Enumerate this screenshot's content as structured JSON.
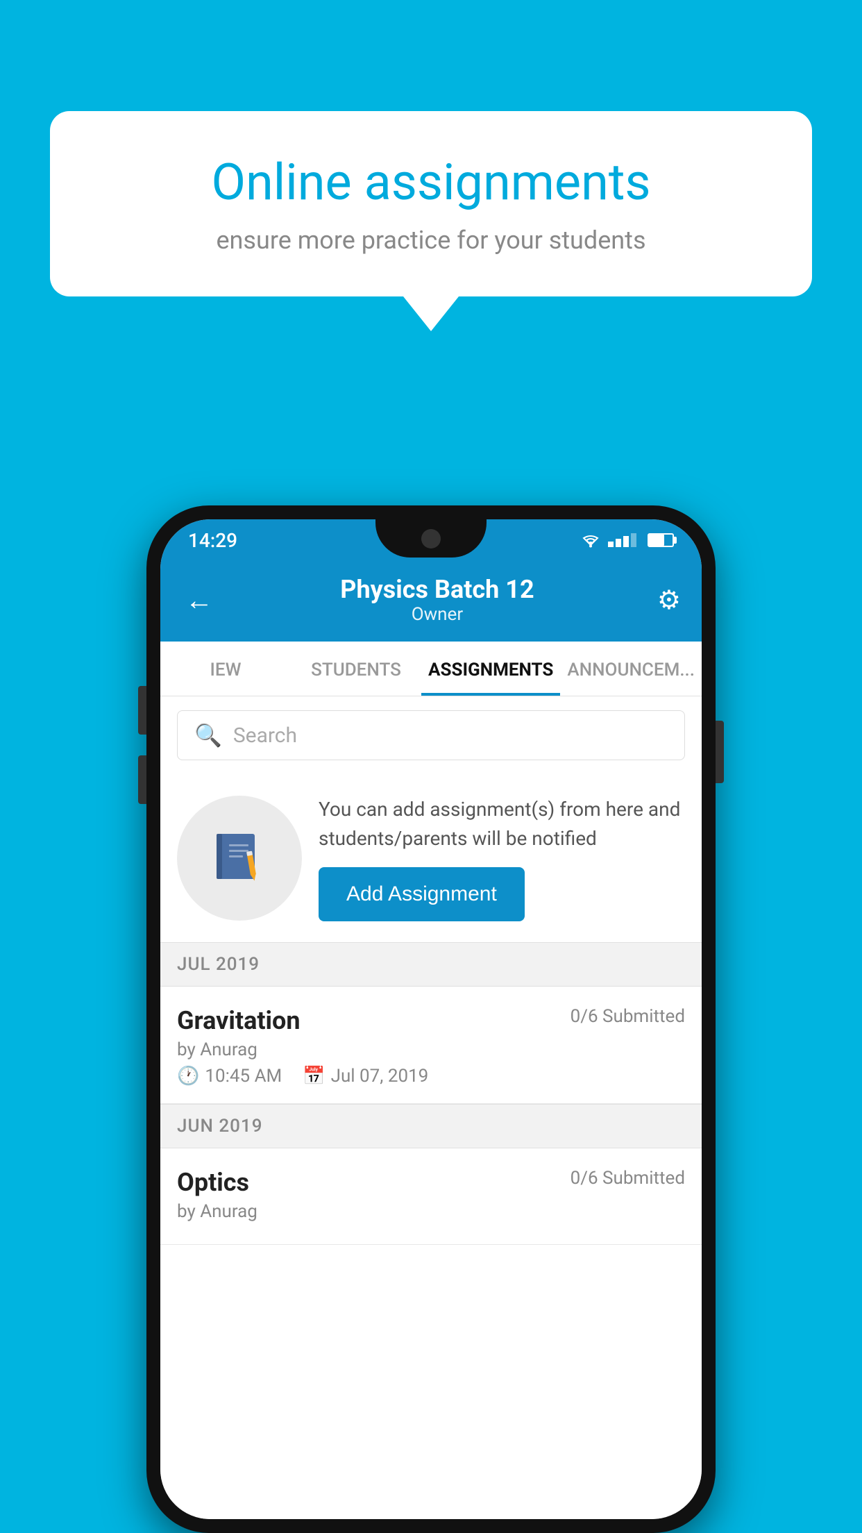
{
  "background": {
    "color": "#00b4e0"
  },
  "speech_bubble": {
    "title": "Online assignments",
    "subtitle": "ensure more practice for your students"
  },
  "phone": {
    "status_bar": {
      "time": "14:29"
    },
    "header": {
      "title": "Physics Batch 12",
      "subtitle": "Owner",
      "back_label": "←",
      "gear_label": "⚙"
    },
    "tabs": [
      {
        "label": "IEW",
        "active": false
      },
      {
        "label": "STUDENTS",
        "active": false
      },
      {
        "label": "ASSIGNMENTS",
        "active": true
      },
      {
        "label": "ANNOUNCEM...",
        "active": false
      }
    ],
    "search": {
      "placeholder": "Search"
    },
    "promo": {
      "text": "You can add assignment(s) from here and students/parents will be notified",
      "button_label": "Add Assignment"
    },
    "sections": [
      {
        "label": "JUL 2019",
        "assignments": [
          {
            "name": "Gravitation",
            "submitted": "0/6 Submitted",
            "by": "by Anurag",
            "time": "10:45 AM",
            "date": "Jul 07, 2019"
          }
        ]
      },
      {
        "label": "JUN 2019",
        "assignments": [
          {
            "name": "Optics",
            "submitted": "0/6 Submitted",
            "by": "by Anurag",
            "time": "",
            "date": ""
          }
        ]
      }
    ]
  }
}
